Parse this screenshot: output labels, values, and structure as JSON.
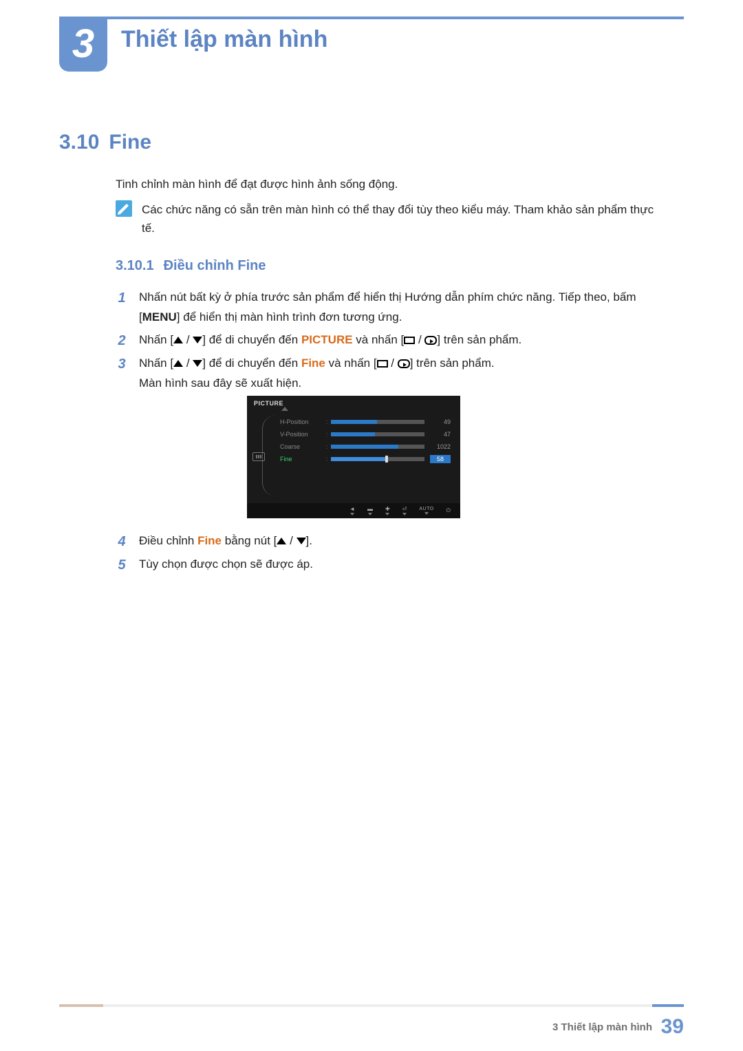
{
  "chapter": {
    "number": "3",
    "title": "Thiết lập màn hình"
  },
  "section": {
    "number": "3.10",
    "title": "Fine",
    "intro": "Tinh chỉnh màn hình để đạt được hình ảnh sống động.",
    "note": "Các chức năng có sẵn trên màn hình có thể thay đổi tùy theo kiểu máy. Tham khảo sản phẩm thực tế."
  },
  "subsection": {
    "number": "3.10.1",
    "title": "Điều chỉnh Fine"
  },
  "steps": {
    "s1_a": "Nhấn nút bất kỳ ở phía trước sản phẩm để hiển thị Hướng dẫn phím chức năng. Tiếp theo, bấm [",
    "s1_menu": "MENU",
    "s1_b": "] để hiển thị màn hình trình đơn tương ứng.",
    "s2_a": "Nhấn [",
    "s2_b": "] để di chuyển đến ",
    "s2_kw": "PICTURE",
    "s2_c": " và nhấn [",
    "s2_d": "] trên sản phẩm.",
    "s3_a": "Nhấn [",
    "s3_b": "] để di chuyển đến ",
    "s3_kw": "Fine",
    "s3_c": " và nhấn [",
    "s3_d": "] trên sản phẩm.",
    "s3_e": "Màn hình sau đây sẽ xuất hiện.",
    "s4_a": "Điều chỉnh ",
    "s4_kw": "Fine",
    "s4_b": " bằng nút [",
    "s4_c": "].",
    "s5": "Tùy chọn được chọn sẽ được áp."
  },
  "nums": {
    "n1": "1",
    "n2": "2",
    "n3": "3",
    "n4": "4",
    "n5": "5"
  },
  "osd": {
    "title": "PICTURE",
    "rows": [
      {
        "label": "H-Position",
        "value": "49",
        "pct": 49
      },
      {
        "label": "V-Position",
        "value": "47",
        "pct": 47
      },
      {
        "label": "Coarse",
        "value": "1022",
        "pct": 72
      },
      {
        "label": "Fine",
        "value": "58",
        "pct": 58
      }
    ],
    "footer_auto": "AUTO"
  },
  "footer": {
    "text": "3 Thiết lập màn hình",
    "page": "39"
  }
}
